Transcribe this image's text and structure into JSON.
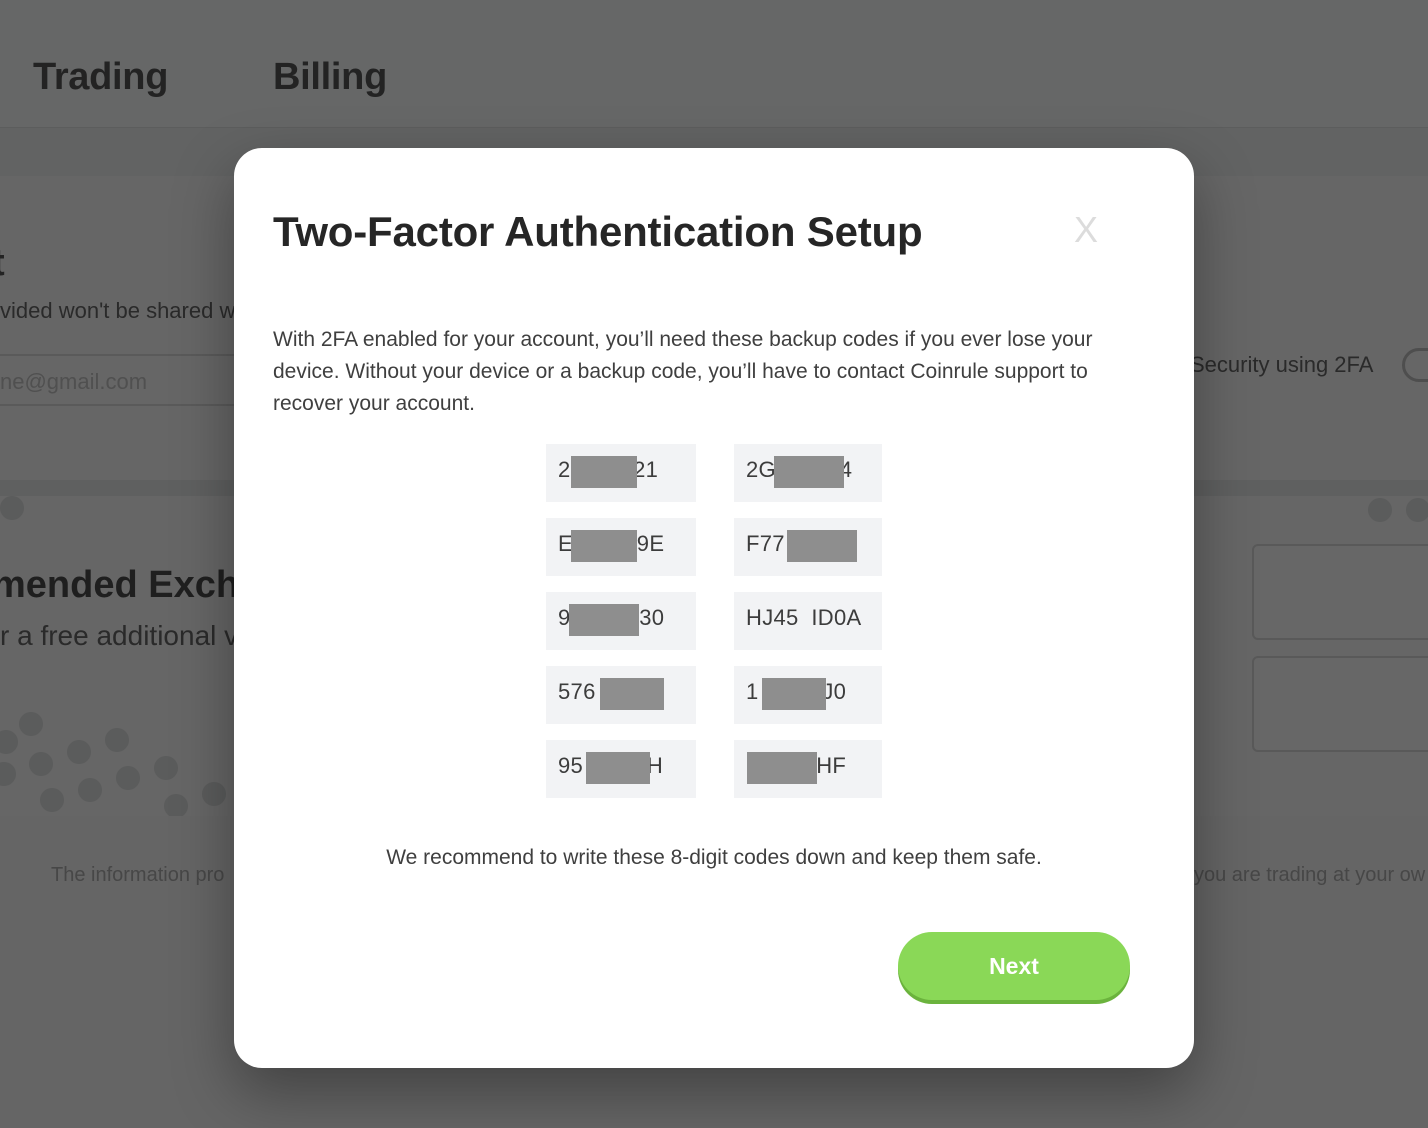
{
  "background": {
    "tabs": [
      {
        "label": "Trading"
      },
      {
        "label": "Billing"
      }
    ],
    "account": {
      "heading_fragment": "t",
      "subtitle_fragment": "vided won't be shared wi",
      "email_placeholder_fragment": "ne@gmail.com",
      "security_label_fragment": "Security using 2FA",
      "two_factor_enabled": false
    },
    "exchanges": {
      "heading_fragment": "mended Exchan",
      "subtitle_fragment": "r a free additional v"
    },
    "footer": {
      "left_fragment": "The information pro",
      "right_fragment": "you are trading at your ow"
    }
  },
  "modal": {
    "title": "Two-Factor Authentication Setup",
    "close_label": "X",
    "description": "With 2FA enabled for your account, you’ll need these backup codes if you ever lose your device. Without your device or a backup code, you’ll have to contact Coinrule support to recover your account.",
    "backup_codes": [
      {
        "text": "2        J21",
        "masked": true
      },
      {
        "text": "2G        44",
        "masked": true
      },
      {
        "text": "E        19E",
        "masked": true
      },
      {
        "text": "F77       H",
        "masked": true
      },
      {
        "text": "9        G30",
        "masked": true
      },
      {
        "text": "HJ45  ID0A",
        "masked": false
      },
      {
        "text": "576        8",
        "masked": true
      },
      {
        "text": "1        8J0",
        "masked": true
      },
      {
        "text": "95        3H",
        "masked": true
      },
      {
        "text": "         7HF",
        "masked": true
      }
    ],
    "recommendation": "We recommend to write these 8-digit codes down and keep them safe.",
    "next_label": "Next",
    "colors": {
      "next_button": "#8ad857",
      "code_background": "#f2f3f5",
      "mask": "#8e8e8e"
    }
  }
}
